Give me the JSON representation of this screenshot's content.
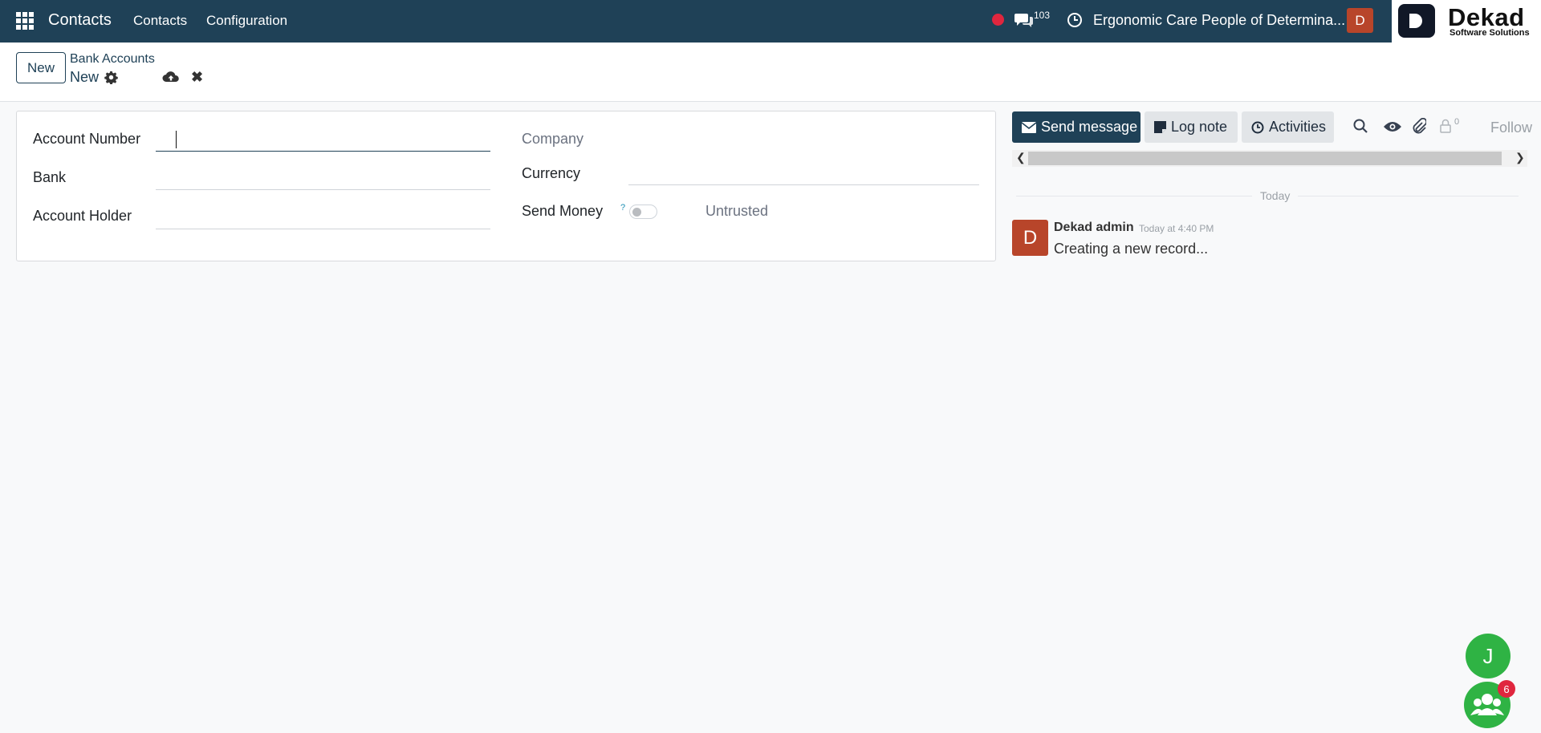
{
  "navbar": {
    "app_name": "Contacts",
    "menu": [
      "Contacts",
      "Configuration"
    ],
    "messages_count": "103",
    "company": "Ergonomic Care People of Determina...",
    "user_initial": "D",
    "logo_name": "Dekad",
    "logo_tagline": "Software Solutions"
  },
  "control_panel": {
    "new_label": "New",
    "breadcrumb_parent": "Bank Accounts",
    "breadcrumb_current": "New"
  },
  "form": {
    "account_number_label": "Account Number",
    "account_number_value": "",
    "bank_label": "Bank",
    "bank_value": "",
    "account_holder_label": "Account Holder",
    "account_holder_value": "",
    "company_label": "Company",
    "currency_label": "Currency",
    "currency_value": "",
    "send_money_label": "Send Money",
    "send_money_help": "?",
    "send_money_enabled": false,
    "send_money_status": "Untrusted"
  },
  "chatter": {
    "send_message_label": "Send message",
    "log_note_label": "Log note",
    "activities_label": "Activities",
    "followers_count": "0",
    "follow_label": "Follow",
    "date_separator": "Today",
    "messages": [
      {
        "avatar_initial": "D",
        "author": "Dekad admin",
        "time": "Today at 4:40 PM",
        "body": "Creating a new record..."
      }
    ]
  },
  "floating": {
    "user_initial": "J",
    "notification_count": "6"
  },
  "colors": {
    "navbar": "#1f4157",
    "avatar": "#b8452a",
    "recording": "#e0263e",
    "bubble": "#2fb344"
  }
}
